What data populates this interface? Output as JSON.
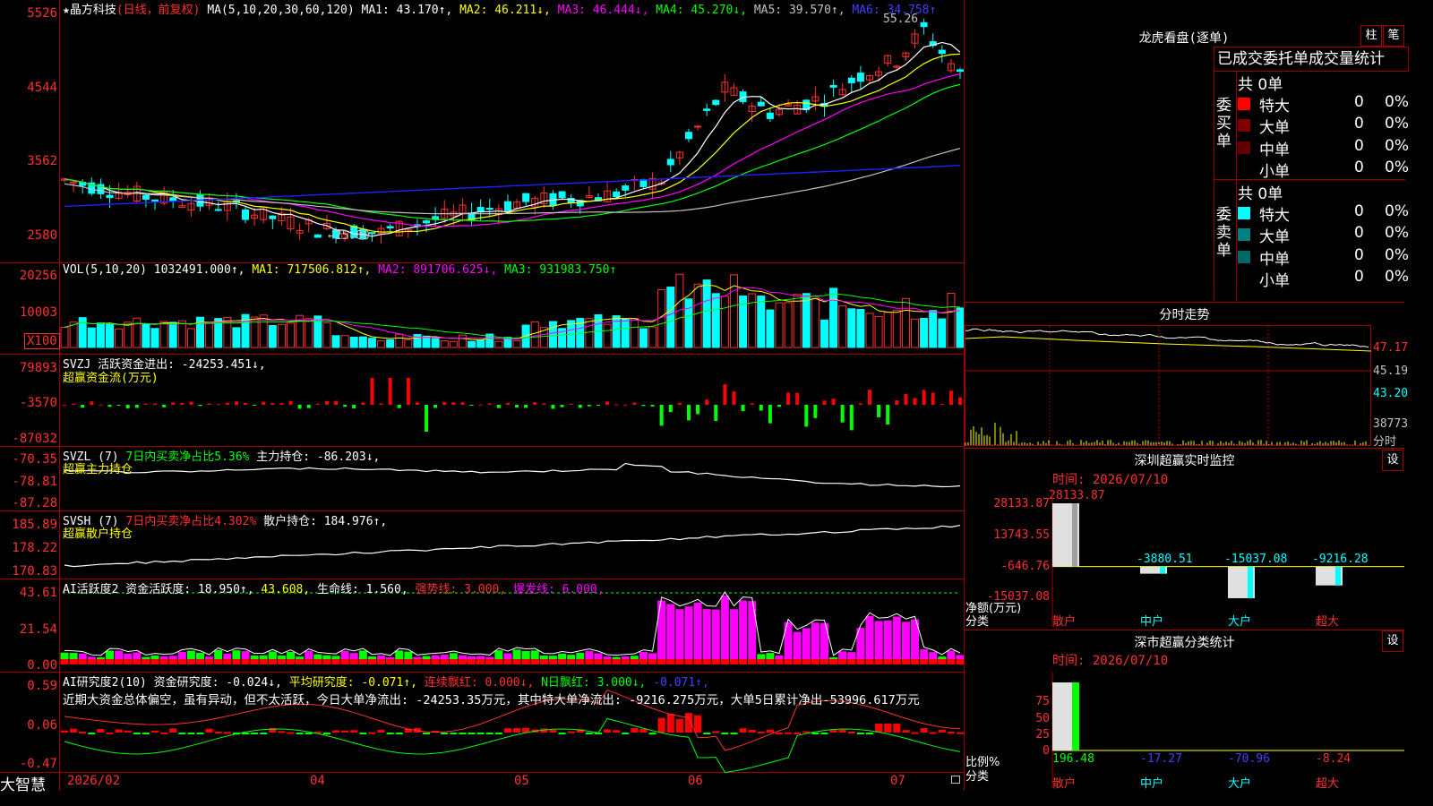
{
  "main": {
    "stock_name": "★晶方科技",
    "period": "(日线，前复权)",
    "ma_header": "MA(5,10,20,30,60,120)",
    "ma1": "MA1: 43.170↑,",
    "ma2": "MA2: 46.211↓,",
    "ma3": "MA3: 46.444↓,",
    "ma4": "MA4: 45.270↓,",
    "ma5": "MA5: 39.570↑,",
    "ma6": "MA6: 34.758↑",
    "yticks": [
      "5526",
      "4544",
      "3562",
      "2580"
    ],
    "high_label": "55.26",
    "low_label": "←25.80"
  },
  "vol": {
    "header": "VOL(5,10,20) 1032491.000↑,",
    "ma1": "MA1: 717506.812↑,",
    "ma2": "MA2: 891706.625↓,",
    "ma3": "MA3: 931983.750↑",
    "yticks": [
      "20256",
      "10003"
    ],
    "unit": "X100"
  },
  "svzj": {
    "header": "SVZJ  活跃资金进出: -24253.451↓,",
    "subtitle": "超赢资金流(万元)",
    "yticks": [
      "79893",
      "-3570",
      "-87032"
    ]
  },
  "svzl": {
    "header": "SVZL (7)",
    "ratio": "7日内买卖净占比5.36%",
    "holding": "主力持仓: -86.203↓,",
    "subtitle": "超赢主力持仓",
    "yticks": [
      "-70.35",
      "-78.81",
      "-87.28"
    ]
  },
  "svsh": {
    "header": "SVSH (7)",
    "ratio": "7日内买卖净占比4.302%",
    "holding": "散户持仓: 184.976↑,",
    "subtitle": "超赢散户持仓",
    "yticks": [
      "185.89",
      "178.22",
      "170.83"
    ]
  },
  "ai_active": {
    "header": "AI活跃度2 资金活跃度: 18.950↑,",
    "v2": "43.608,",
    "life": "生命线: 1.560,",
    "strong": "强势线: 3.000,",
    "burst": "爆发线: 6.000,",
    "yticks": [
      "43.61",
      "21.54",
      "0.00"
    ]
  },
  "ai_research": {
    "header": "AI研究度2(10) 资金研究度: -0.024↓,",
    "avg": "平均研究度: -0.071↑,",
    "red": "连续飘红: 0.000↓,",
    "nred": "N日飘红: 3.000↓,",
    "last": "-0.071↑,",
    "comment": "近期大资金总体偏空，虽有异动，但不太活跃，今日大单净流出: -24253.35万元，其中特大单净流出: -9216.275万元，大单5日累计净出-53996.617万元",
    "yticks": [
      "0.59",
      "0.06",
      "-0.47"
    ]
  },
  "xaxis": {
    "brand": "大智慧",
    "labels": [
      "2026/02",
      "04",
      "05",
      "06",
      "07"
    ]
  },
  "right": {
    "dragon_title": "龙虎看盘(逐单)",
    "btn_bar": "柱",
    "btn_pen": "笔",
    "tabs_title": "已成交委托单成交量统计",
    "buy_label": "委买单",
    "sell_label": "委卖单",
    "buy_total": "共 0单",
    "sell_total": "共 0单",
    "buy_rows": [
      {
        "name": "特大",
        "val": "0",
        "pct": "0%",
        "color": "#ff0000"
      },
      {
        "name": "大单",
        "val": "0",
        "pct": "0%",
        "color": "#800000"
      },
      {
        "name": "中单",
        "val": "0",
        "pct": "0%",
        "color": "#600000"
      },
      {
        "name": "小单",
        "val": "0",
        "pct": "0%",
        "color": "#000000"
      }
    ],
    "sell_rows": [
      {
        "name": "特大",
        "val": "0",
        "pct": "0%",
        "color": "#00ffff"
      },
      {
        "name": "大单",
        "val": "0",
        "pct": "0%",
        "color": "#008080"
      },
      {
        "name": "中单",
        "val": "0",
        "pct": "0%",
        "color": "#006868"
      },
      {
        "name": "小单",
        "val": "0",
        "pct": "0%",
        "color": "#000000"
      }
    ],
    "intraday_title": "分时走势",
    "intraday_yticks": [
      "47.17",
      "45.19",
      "43.20",
      "38773",
      "分时"
    ],
    "sz_monitor_title": "深圳超赢实时监控",
    "sz_set": "设",
    "sz_time": "时间: 2026/07/10",
    "sz_yticks": [
      "28133.87",
      "13743.55",
      "-646.76",
      "-15037.08"
    ],
    "sz_ylabel": "净额(万元)",
    "sz_xlabel": "分类",
    "sz_bars": [
      {
        "cat": "散户",
        "value": "28133.87"
      },
      {
        "cat": "中户",
        "value": "-3880.51"
      },
      {
        "cat": "大户",
        "value": "-15037.08"
      },
      {
        "cat": "超大",
        "value": "-9216.28"
      }
    ],
    "sz_stats_title": "深市超赢分类统计",
    "stats_set": "设",
    "stats_time": "时间: 2026/07/10",
    "stats_yticks": [
      "75",
      "50",
      "25",
      "0"
    ],
    "stats_ylabel": "比例%",
    "stats_xlabel": "分类",
    "stats_bars": [
      {
        "cat": "散户",
        "value": "196.48"
      },
      {
        "cat": "中户",
        "value": "-17.27"
      },
      {
        "cat": "大户",
        "value": "-70.96"
      },
      {
        "cat": "超大",
        "value": "-8.24"
      }
    ]
  },
  "colors": {
    "up": "#ff3030",
    "down": "#00ffff",
    "grid": "#a00000",
    "ma1": "#ffffff",
    "ma2": "#ffff00",
    "ma3": "#ff00ff",
    "ma4": "#00ff00",
    "ma5": "#c0c0c0",
    "ma6": "#2020ff"
  }
}
